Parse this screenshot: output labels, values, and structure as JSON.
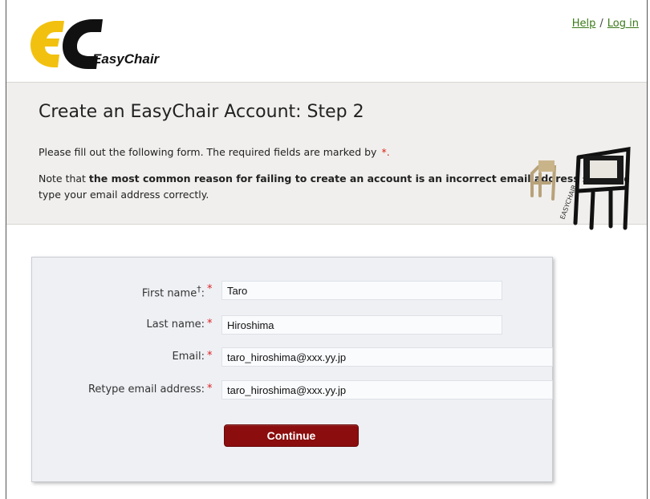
{
  "app": {
    "logo_text": "EasyChair"
  },
  "topnav": {
    "help": "Help",
    "separator": "/",
    "login": "Log in"
  },
  "header": {
    "title": "Create an EasyChair Account: Step 2",
    "instruction": "Please fill out the following form. The required fields are marked by",
    "required_marker": "*.",
    "note_prefix": "Note that ",
    "note_bold": "the most common reason for failing to create an account is an incorrect email address",
    "note_suffix": " so please type your email address correctly."
  },
  "form": {
    "first_name": {
      "label": "First name",
      "sup": "†",
      "colon": ":",
      "value": "Taro"
    },
    "last_name": {
      "label": "Last name:",
      "value": "Hiroshima"
    },
    "email": {
      "label": "Email:",
      "value": "taro_hiroshima@xxx.yy.jp"
    },
    "retype_email": {
      "label": "Retype email address:",
      "value": "taro_hiroshima@xxx.yy.jp"
    },
    "required_star": "*",
    "continue_label": "Continue"
  },
  "colors": {
    "link": "#3b7a1a",
    "required": "#dd2222",
    "button": "#8b0d0d",
    "logo_yellow": "#f2c10f",
    "header_bg": "#f0efed"
  },
  "icons": {
    "logo": "easychair-logo",
    "decoration": "chairs-illustration"
  }
}
